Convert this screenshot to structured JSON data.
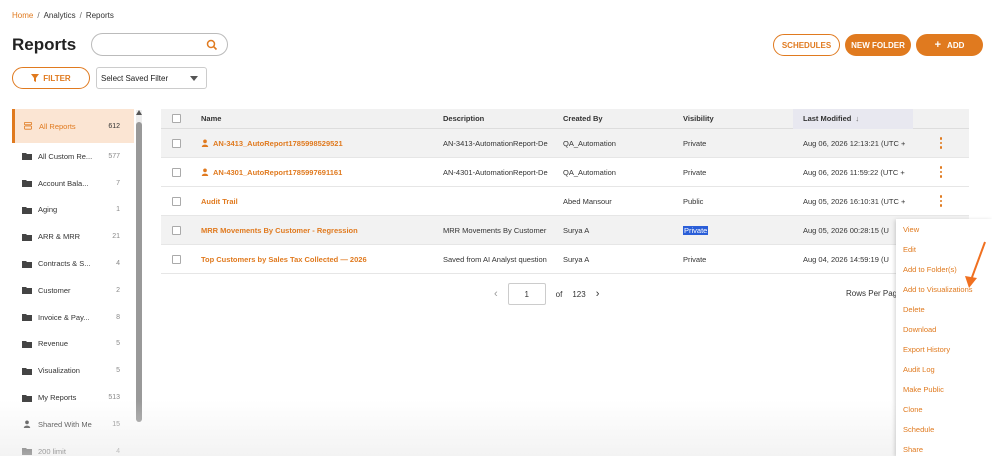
{
  "breadcrumb": {
    "home": "Home",
    "analytics": "Analytics",
    "current": "Reports",
    "sep": "/"
  },
  "page_title": "Reports",
  "search": {
    "value": "",
    "placeholder": ""
  },
  "filter_button": "FILTER",
  "saved_filter": {
    "selected": "Select Saved Filter"
  },
  "toolbar": {
    "schedules": "SCHEDULES",
    "new_folder": "NEW FOLDER",
    "add": "ADD",
    "add_plus": "+"
  },
  "sidebar": {
    "items": [
      {
        "label": "All Reports",
        "count": "612"
      },
      {
        "label": "All Custom Re...",
        "count": "577"
      },
      {
        "label": "Account Bala...",
        "count": "7"
      },
      {
        "label": "Aging",
        "count": "1"
      },
      {
        "label": "ARR & MRR",
        "count": "21"
      },
      {
        "label": "Contracts & S...",
        "count": "4"
      },
      {
        "label": "Customer",
        "count": "2"
      },
      {
        "label": "Invoice & Pay...",
        "count": "8"
      },
      {
        "label": "Revenue",
        "count": "5"
      },
      {
        "label": "Visualization",
        "count": "5"
      },
      {
        "label": "My Reports",
        "count": "513"
      },
      {
        "label": "Shared With Me",
        "count": "15"
      },
      {
        "label": "200 limit",
        "count": "4"
      }
    ]
  },
  "table": {
    "headers": {
      "name": "Name",
      "description": "Description",
      "created_by": "Created By",
      "visibility": "Visibility",
      "last_modified": "Last Modified",
      "sort_icon": "↓"
    },
    "rows": [
      {
        "name": "AN-3413_AutoReport1785998529521",
        "description": "AN-3413-AutomationReport-De",
        "created_by": "QA_Automation",
        "visibility": "Private",
        "modified": "Aug 06, 2026 12:13:21 (UTC +"
      },
      {
        "name": "AN-4301_AutoReport1785997691161",
        "description": "AN-4301-AutomationReport-De",
        "created_by": "QA_Automation",
        "visibility": "Private",
        "modified": "Aug 06, 2026 11:59:22 (UTC +"
      },
      {
        "name": "Audit Trail",
        "description": "",
        "created_by": "Abed Mansour",
        "visibility": "Public",
        "modified": "Aug 05, 2026 16:10:31 (UTC +"
      },
      {
        "name": "MRR Movements By Customer - Regression",
        "description": "MRR Movements By Customer",
        "created_by": "Surya A",
        "visibility": "Private",
        "modified": "Aug 05, 2026 00:28:15 (U"
      },
      {
        "name": "Top Customers by Sales Tax Collected — 2026",
        "description": "Saved from AI Analyst question",
        "created_by": "Surya A",
        "visibility": "Private",
        "modified": "Aug 04, 2026 14:59:19 (U"
      }
    ]
  },
  "pagination": {
    "current": "1",
    "of_label": "of",
    "total": "123",
    "prev": "‹",
    "next": "›",
    "rows_per_page": "Rows Per Pag"
  },
  "context_menu": {
    "items": [
      "View",
      "Edit",
      "Add to Folder(s)",
      "Add to Visualizations",
      "Delete",
      "Download",
      "Export History",
      "Audit Log",
      "Make Public",
      "Clone",
      "Schedule",
      "Share"
    ]
  },
  "colors": {
    "accent": "#e07a1f",
    "selection": "#2a5ed8",
    "annotation_arrow": "#f07020"
  }
}
